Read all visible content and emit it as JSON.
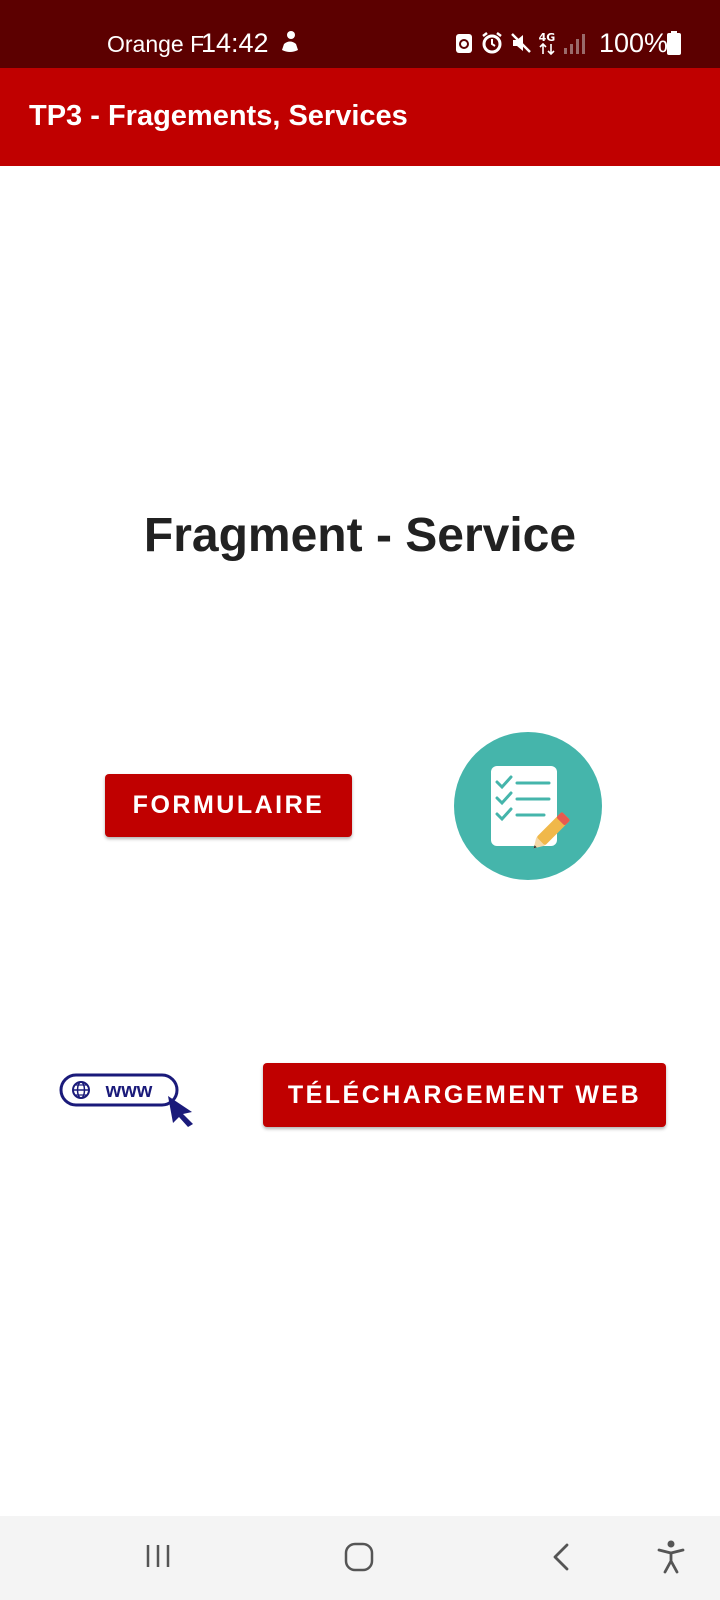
{
  "status_bar": {
    "carrier": "Orange F",
    "time": "14:42",
    "network": "4G",
    "battery": "100%"
  },
  "app_bar": {
    "title": "TP3 - Fragements, Services"
  },
  "main": {
    "title": "Fragment - Service",
    "form_button_label": "FORMULAIRE",
    "web_button_label": "TÉLÉCHARGEMENT WEB",
    "www_label": "www"
  },
  "colors": {
    "primary": "#c00000",
    "status_bar": "#5c0000",
    "form_icon_bg": "#45b5ab",
    "www_icon": "#1a1a7a"
  }
}
